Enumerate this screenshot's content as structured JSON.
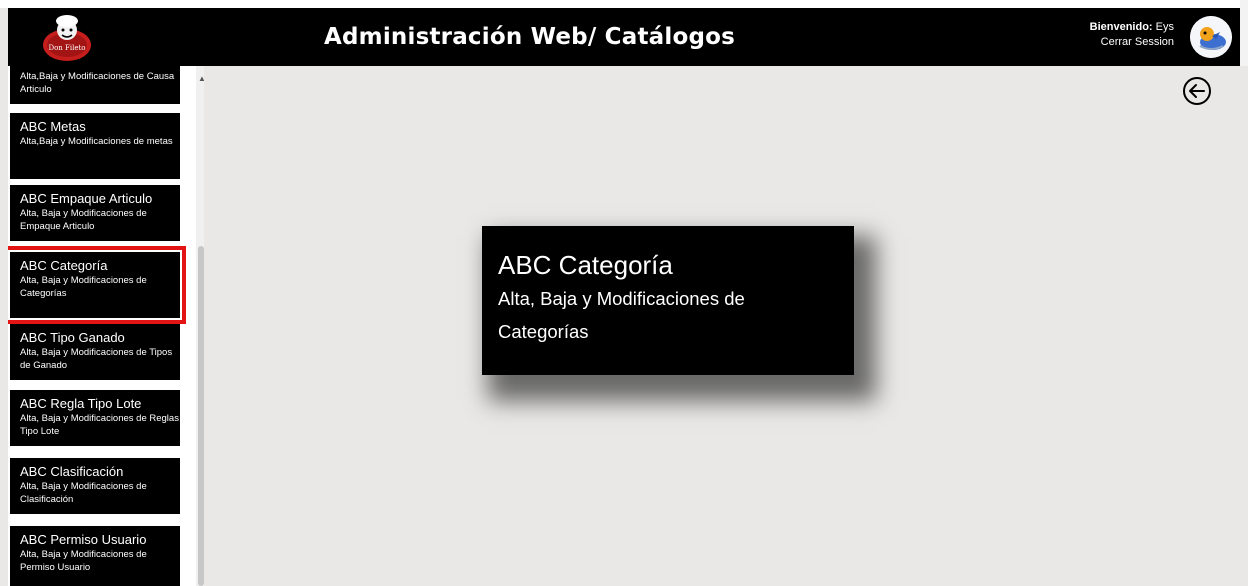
{
  "header": {
    "title": "Administración Web/ Catálogos",
    "welcome_label": "Bienvenido:",
    "user_name": "Eys",
    "logout_label": "Cerrar Session",
    "logo_text": "Don Fileto"
  },
  "sidebar": {
    "items": [
      {
        "title": "",
        "subtitle": "Alta,Baja y Modificaciones de Causa Articulo"
      },
      {
        "title": "ABC Metas",
        "subtitle": "Alta,Baja y Modificaciones de metas"
      },
      {
        "title": "ABC Empaque Articulo",
        "subtitle": "Alta, Baja y Modificaciones de Empaque Articulo"
      },
      {
        "title": "ABC Categoría",
        "subtitle": "Alta, Baja y Modificaciones de Categorías"
      },
      {
        "title": "ABC Tipo Ganado",
        "subtitle": "Alta, Baja y Modificaciones de Tipos de Ganado"
      },
      {
        "title": "ABC Regla Tipo Lote",
        "subtitle": "Alta, Baja y Modificaciones de Reglas Tipo Lote"
      },
      {
        "title": "ABC Clasificación",
        "subtitle": "Alta, Baja y Modificaciones de Clasificación"
      },
      {
        "title": "ABC Permiso Usuario",
        "subtitle": "Alta, Baja y Modificaciones de Permiso Usuario"
      }
    ],
    "selected_index": 3
  },
  "main": {
    "card_title": "ABC Categoría",
    "card_subtitle": "Alta, Baja y Modificaciones de Categorías"
  },
  "icons": {
    "back": "arrow-left-circle-icon",
    "scroll_up": "caret-up-icon"
  },
  "colors": {
    "selected_outline": "#e31414",
    "tile_bg": "#000000",
    "page_bg": "#e9e8e6"
  }
}
